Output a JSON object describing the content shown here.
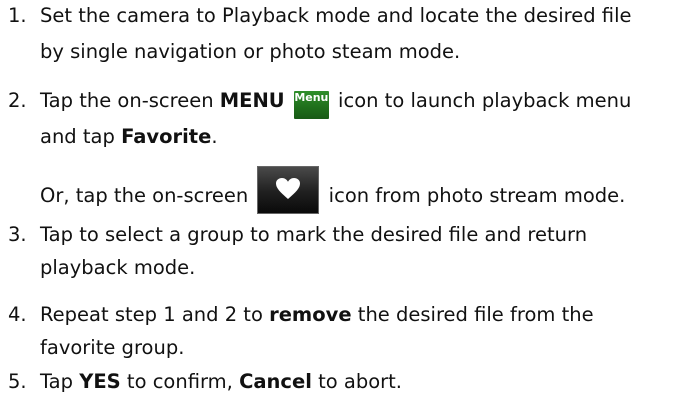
{
  "steps": [
    {
      "num": "1.",
      "line1": "Set the camera to Playback mode and locate the desired file",
      "line2": "by single navigation or photo steam mode."
    },
    {
      "num": "2.",
      "pre": "Tap the on-screen ",
      "menu_bold": "MENU",
      "menu_icon_label": "Menu",
      "post": " icon to launch playback menu",
      "line2_pre": "and tap ",
      "favorite_bold": "Favorite",
      "line2_post": ".",
      "alt_pre": "Or, tap the on-screen ",
      "alt_post": " icon from photo stream mode."
    },
    {
      "num": "3.",
      "line1": "Tap to select a group to mark the desired file and return",
      "line2": "playback mode."
    },
    {
      "num": "4.",
      "pre": "Repeat step 1 and 2 to ",
      "remove_bold": "remove",
      "post": " the desired file from the",
      "line2": "favorite group."
    },
    {
      "num": "5.",
      "pre": "Tap ",
      "yes_bold": "YES",
      "mid": " to confirm, ",
      "cancel_bold": "Cancel",
      "post": " to abort."
    }
  ],
  "icons": {
    "menu_icon_color": "#2a7f25",
    "heart_icon_color": "#1f1f1f"
  }
}
